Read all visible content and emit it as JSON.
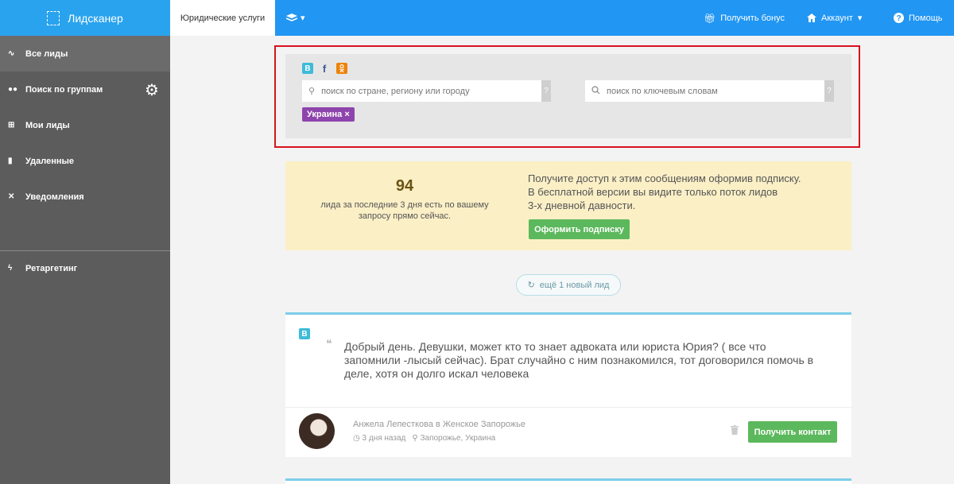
{
  "header": {
    "logo": "Лидсканер",
    "active_tab": "Юридические услуги",
    "bonus": "Получить бонус",
    "account": "Аккаунт",
    "help": "Помощь"
  },
  "sidebar": {
    "items": [
      {
        "label": "Все лиды",
        "icon": "pulse-icon"
      },
      {
        "label": "Поиск по группам",
        "icon": "users-icon"
      },
      {
        "label": "Мои лиды",
        "icon": "cart-icon"
      },
      {
        "label": "Удаленные",
        "icon": "trash-icon"
      },
      {
        "label": "Уведомления",
        "icon": "bell-off-icon"
      },
      {
        "label": "Ретаргетинг",
        "icon": "bolt-icon"
      }
    ]
  },
  "search": {
    "location_placeholder": "поиск по стране, региону или городу",
    "keywords_placeholder": "поиск по ключевым словам",
    "help_mark": "?",
    "tag": "Украина ×",
    "social": {
      "vk": "В",
      "fb": "f",
      "ok": "ok"
    }
  },
  "promo": {
    "count": "94",
    "count_text": "лида за последние 3 дня есть по вашему запросу прямо сейчас.",
    "text_line1": "Получите доступ к этим сообщениям оформив подписку.",
    "text_line2": "В бесплатной версии вы видите только поток лидов",
    "text_line3": "3-х дневной давности.",
    "button": "Оформить подписку"
  },
  "new_leads": "ещё 1 новый лид",
  "lead": {
    "network": "В",
    "text": "Добрый день. Девушки, может кто то знает адвоката или юриста Юрия? ( все что запомнили -лысый сейчас). Брат случайно с ним познакомился, тот договорился помочь в деле, хотя он долго искал человека",
    "author": "Анжела Лепесткова в Женское Запорожье",
    "time": "3 дня назад",
    "location": "Запорожье, Украина",
    "button": "Получить контакт"
  },
  "colors": {
    "topbar": "#2196f3",
    "sidebar": "#5c5c5c",
    "accent_green": "#5cb85c",
    "tag_purple": "#8e44ad",
    "highlight_red": "#d9121e"
  }
}
